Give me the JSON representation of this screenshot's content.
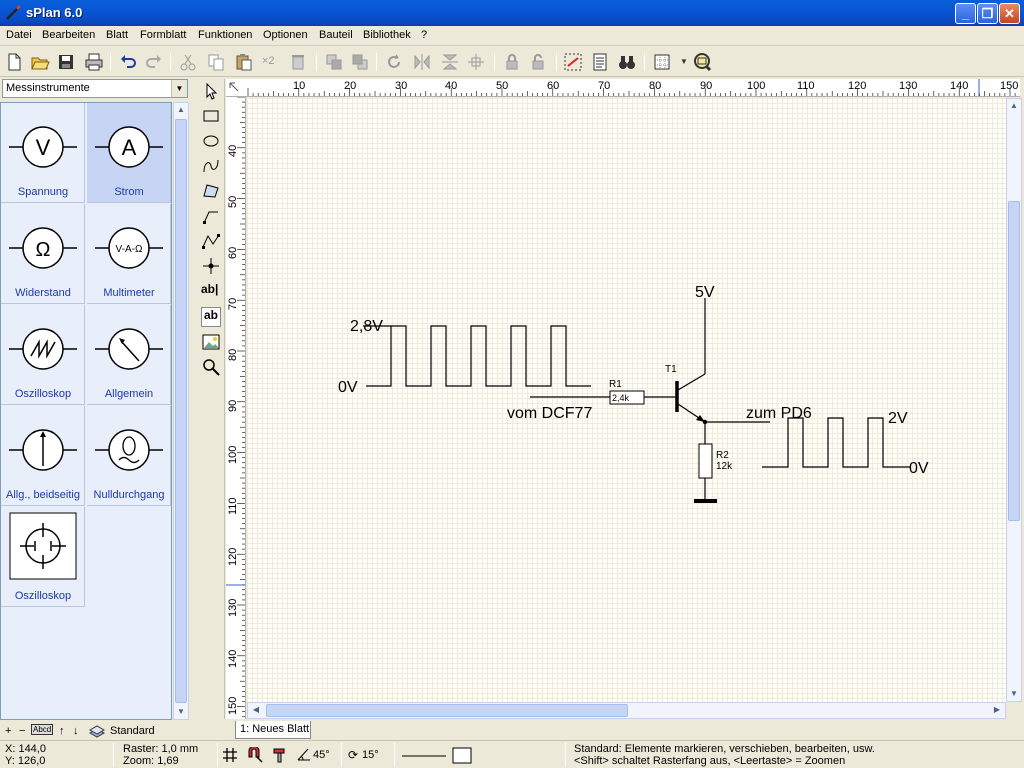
{
  "window": {
    "title": "sPlan 6.0"
  },
  "menu": [
    "Datei",
    "Bearbeiten",
    "Blatt",
    "Formblatt",
    "Funktionen",
    "Optionen",
    "Bauteil",
    "Bibliothek",
    "?"
  ],
  "toolbar": {
    "multiply_label": "×2"
  },
  "library": {
    "selected": "Messinstrumente",
    "items": [
      {
        "label": "Spannung",
        "symbol": "V"
      },
      {
        "label": "Strom",
        "symbol": "A"
      },
      {
        "label": "Widerstand",
        "symbol": "Ω"
      },
      {
        "label": "Multimeter",
        "symbol": "V-A-Ω"
      },
      {
        "label": "Oszilloskop",
        "symbol": ""
      },
      {
        "label": "Allgemein",
        "symbol": ""
      },
      {
        "label": "Allg., beidseitig",
        "symbol": ""
      },
      {
        "label": "Nulldurchgang",
        "symbol": ""
      },
      {
        "label": "Oszilloskop",
        "symbol": ""
      }
    ],
    "bottom": {
      "plus": "+",
      "minus": "−",
      "abcd": "Abcd",
      "up": "↑",
      "down": "↓",
      "standard": "Standard"
    }
  },
  "tools": {
    "text_label": "ab|",
    "text_box_label": "ab"
  },
  "rulers": {
    "h": [
      "10",
      "20",
      "30",
      "40",
      "50",
      "60",
      "70",
      "80",
      "90",
      "100",
      "110",
      "120",
      "130",
      "140",
      "150"
    ],
    "v": [
      "40",
      "50",
      "60",
      "70",
      "80",
      "90",
      "100",
      "110",
      "120",
      "130",
      "140",
      "150"
    ]
  },
  "schematic": {
    "supply": "5V",
    "high_level": "2,8V",
    "low_level_in": "0V",
    "input_label": "vom DCF77",
    "r1_name": "R1",
    "r1_value": "2,4k",
    "t1_name": "T1",
    "output_label": "zum PD6",
    "out_high": "2V",
    "out_low": "0V",
    "r2_name": "R2",
    "r2_value": "12k"
  },
  "page_tab": "1: Neues Blatt",
  "status": {
    "x": "X: 144,0",
    "y": "Y: 126,0",
    "raster": "Raster: 1,0 mm",
    "zoom": "Zoom:   1,69",
    "angle1": "45°",
    "angle2": "15°",
    "hint1": "Standard: Elemente markieren, verschieben, bearbeiten, usw.",
    "hint2": "<Shift> schaltet Rasterfang aus, <Leertaste> = Zoomen"
  },
  "colors": {
    "titlebar": "#0a5fd8",
    "library_label": "#1d3aa6",
    "library_selected": "#c8d4f4"
  }
}
